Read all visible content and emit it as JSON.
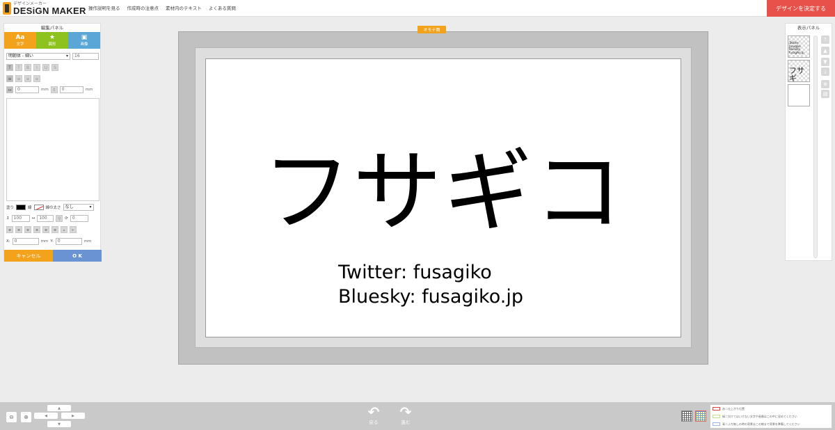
{
  "header": {
    "logo_small": "デザインメーカー",
    "logo_main": "DESiGN MAKER",
    "nav": [
      "操作説明を見る",
      "作成時の注意点",
      "素材内のテキスト",
      "よくある質問"
    ],
    "decide_button": "デザインを決定する"
  },
  "edit_panel": {
    "title": "編集パネル",
    "tabs": [
      {
        "icon": "Aa",
        "label": "文字"
      },
      {
        "icon": "★",
        "label": "図形"
      },
      {
        "icon": "▣",
        "label": "画像"
      }
    ],
    "font_family": "明朝体 - 細い",
    "font_size": "16",
    "letter_spacing": "0",
    "line_spacing": "0",
    "unit_mm": "mm",
    "fill_label": "塗り",
    "stroke_label": "線",
    "stroke_width_label": "線の太さ",
    "stroke_width_value": "なし",
    "scale_h": "100",
    "scale_w": "100",
    "rotation": "0",
    "x_label": "X:",
    "x_value": "0",
    "y_label": "Y:",
    "y_value": "0",
    "cancel_button": "キャンセル",
    "ok_button": "O K"
  },
  "canvas": {
    "side_label": "オモテ面",
    "title": "フサギコ",
    "line1": "Twitter: fusagiko",
    "line2": "Bluesky: fusagiko.jp"
  },
  "display_panel": {
    "title": "表示パネル",
    "thumbs": [
      "Twitter: fusagiko Bluesky: fusagiko.jp",
      "フサギ",
      ""
    ]
  },
  "bottom": {
    "undo_label": "戻る",
    "redo_label": "進む",
    "legend": [
      {
        "text": "赤＝仕上がり位置",
        "color": "#e0443a"
      },
      {
        "text": "緑＝欠けてはいけない文字や画像はこの中に収めてください",
        "color": "#8dc21f"
      },
      {
        "text": "青＝ふち無しの時の背景はこの線まで背景を準備してください",
        "color": "#6a93d4"
      }
    ]
  }
}
